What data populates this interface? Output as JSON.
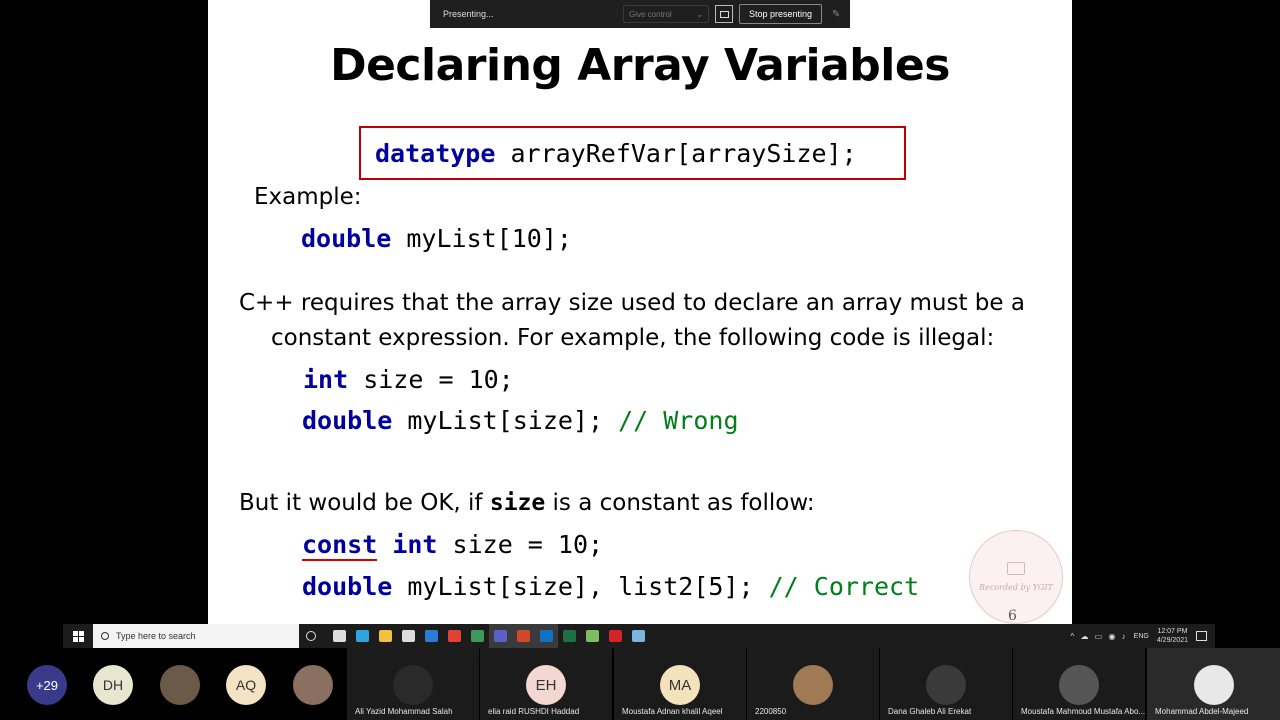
{
  "presenting_bar": {
    "status": "Presenting...",
    "give_control": "Give control",
    "stop_label": "Stop presenting"
  },
  "slide": {
    "title": "Declaring Array Variables",
    "decl_type": "datatype",
    "decl_rest": " arrayRefVar[arraySize];",
    "example_label": "Example:",
    "example_kw": "double",
    "example_rest": " myList[10];",
    "para1_line1": "C++ requires that the array size used to declare an array must be a",
    "para1_line2": "constant expression. For example, the following code is illegal:",
    "code1_kw": "int",
    "code1_rest": " size = 10;",
    "code2_kw": "double",
    "code2_rest": " myList[size]; ",
    "code2_comment": "// Wrong",
    "para2_pre": "But it would be OK, if ",
    "para2_code": "size",
    "para2_post": " is a constant as follow:",
    "code3_kw1": "const",
    "code3_kw2": "int",
    "code3_rest": " size = 10;",
    "code4_kw": "double",
    "code4_rest": " myList[size], list2[5]; ",
    "code4_comment": "// Correct",
    "page_number": "6",
    "watermark_text": "Recorded by YGIT"
  },
  "taskbar": {
    "search_placeholder": "Type here to search",
    "language": "ENG",
    "time": "12:07 PM",
    "date": "4/29/2021",
    "icons": [
      {
        "name": "task-view-icon",
        "color": "#dddddd"
      },
      {
        "name": "edge-icon",
        "color": "#2fa5e0"
      },
      {
        "name": "file-explorer-icon",
        "color": "#f0c040"
      },
      {
        "name": "store-icon",
        "color": "#dddddd"
      },
      {
        "name": "mail-icon",
        "color": "#2b7cd3"
      },
      {
        "name": "chrome-icon",
        "color": "#e34133"
      },
      {
        "name": "photos-icon",
        "color": "#3d9a5a"
      },
      {
        "name": "teams-icon",
        "color": "#5b5fc7"
      },
      {
        "name": "powerpoint-icon",
        "color": "#d24726"
      },
      {
        "name": "outlook-icon",
        "color": "#0f72c5"
      },
      {
        "name": "excel-icon",
        "color": "#1d7044"
      },
      {
        "name": "notepad-icon",
        "color": "#7dbf5e"
      },
      {
        "name": "acrobat-icon",
        "color": "#d3242a"
      },
      {
        "name": "tablet-icon",
        "color": "#7ab6e0"
      }
    ]
  },
  "participants": {
    "more_count": "+29",
    "circles": [
      {
        "initials": "DH",
        "color": "#e8e6cf"
      },
      {
        "initials": "",
        "color": "#6b5a48"
      },
      {
        "initials": "AQ",
        "color": "#f3e3c4"
      },
      {
        "initials": "",
        "color": "#8a7060"
      }
    ],
    "tiles": [
      {
        "name": "Ali Yazid Mohammad Salah",
        "initials": "",
        "color": "#2a2a2a"
      },
      {
        "name": "elia raid  RUSHDI Haddad",
        "initials": "EH",
        "color": "#f5d7d2"
      },
      {
        "name": "Moustafa Adnan khalil Aqeel",
        "initials": "MA",
        "color": "#f4e2bd"
      },
      {
        "name": "2200850",
        "initials": "",
        "color": "#a07a55"
      },
      {
        "name": "Dana Ghaleb Ali Erekat",
        "initials": "",
        "color": "#3a3a3a"
      },
      {
        "name": "Moustafa Mahmoud Mustafa Abo...",
        "initials": "",
        "color": "#555555"
      },
      {
        "name": "Mohammad Abdel-Majeed",
        "initials": "",
        "color": "#e8e8e8"
      }
    ]
  }
}
